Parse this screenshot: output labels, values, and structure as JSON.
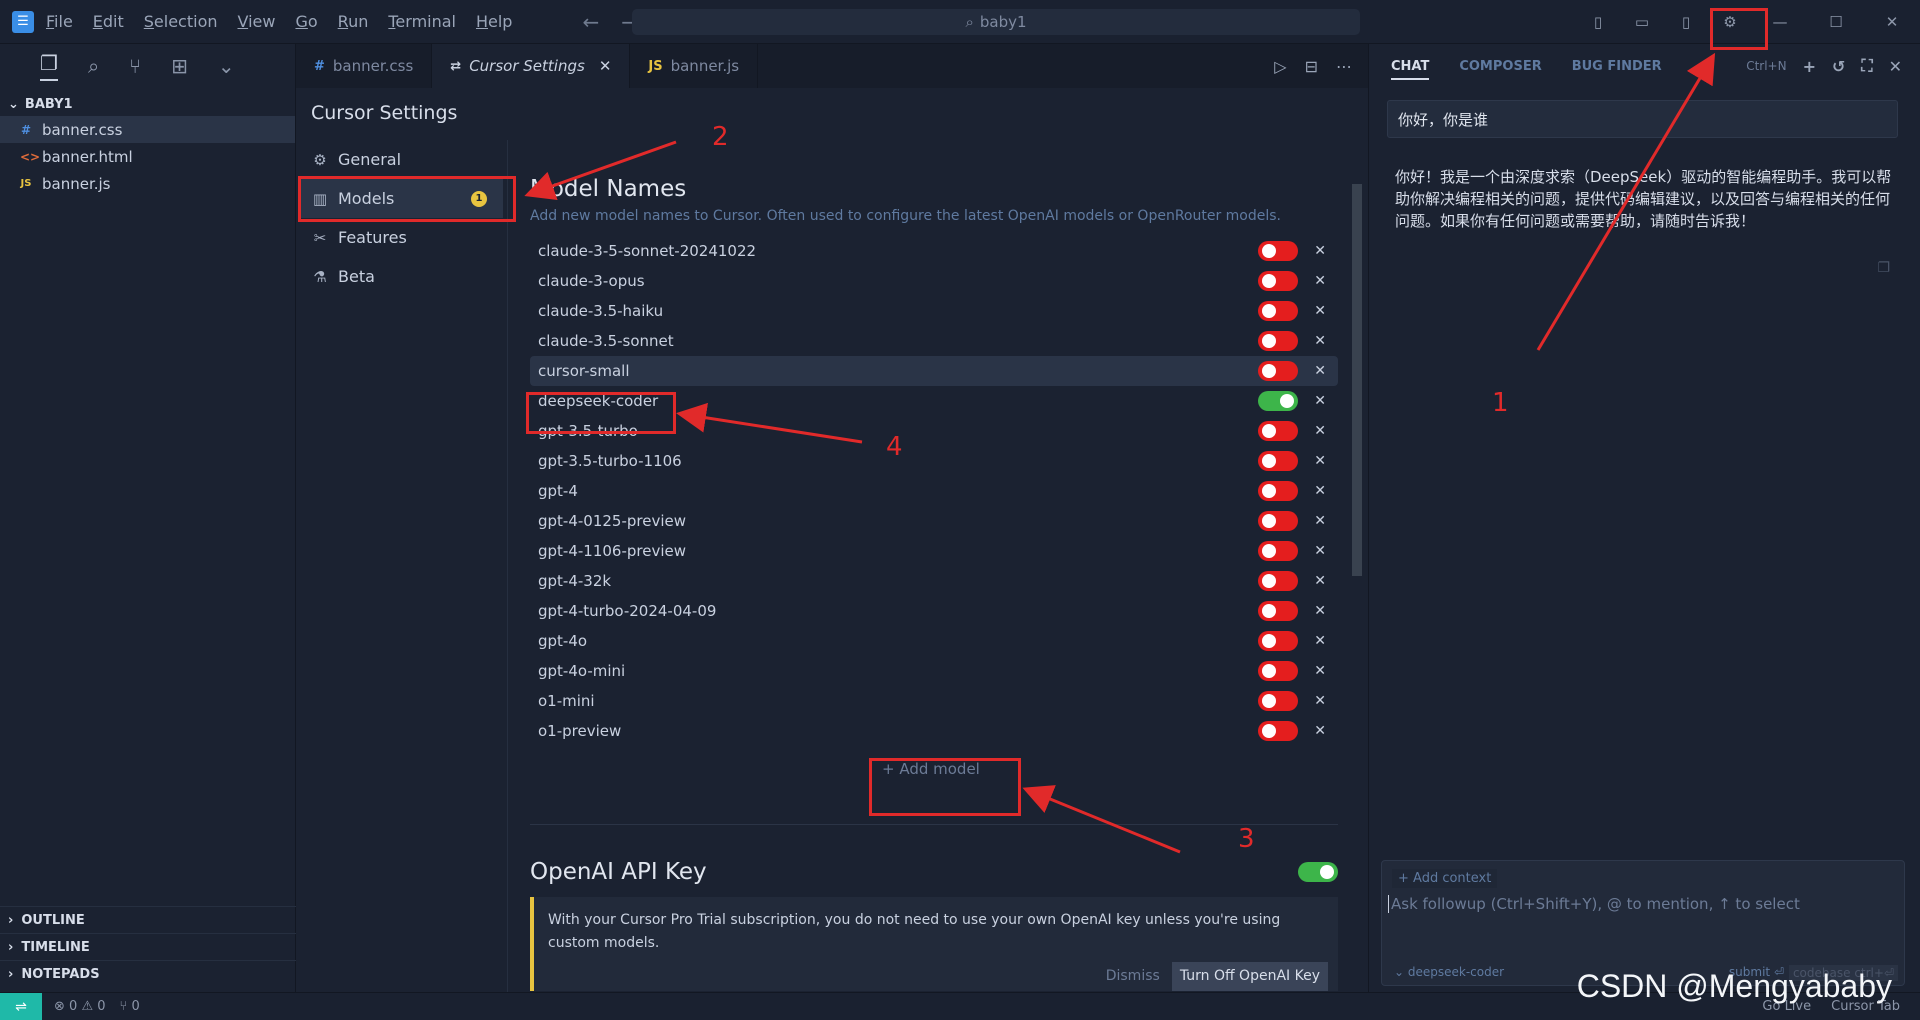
{
  "titlebar": {
    "menus": [
      "File",
      "Edit",
      "Selection",
      "View",
      "Go",
      "Run",
      "Terminal",
      "Help"
    ],
    "search_text": "baby1",
    "colors": {
      "accent": "#3a8ee6"
    }
  },
  "explorer": {
    "folder": "BABY1",
    "files": [
      {
        "name": "banner.css",
        "icon": "#"
      },
      {
        "name": "banner.html",
        "icon": "<>"
      },
      {
        "name": "banner.js",
        "icon": "JS"
      }
    ],
    "sections": [
      "OUTLINE",
      "TIMELINE",
      "NOTEPADS"
    ]
  },
  "tabs": [
    {
      "label": "banner.css",
      "icon": "#"
    },
    {
      "label": "Cursor Settings",
      "icon": "⇄"
    },
    {
      "label": "banner.js",
      "icon": "JS"
    }
  ],
  "settings": {
    "title": "Cursor Settings",
    "nav": [
      {
        "label": "General",
        "icon": "gear-icon"
      },
      {
        "label": "Models",
        "icon": "bar-chart-icon",
        "badge": "1"
      },
      {
        "label": "Features",
        "icon": "tools-icon"
      },
      {
        "label": "Beta",
        "icon": "flask-icon"
      }
    ],
    "model_names_title": "Model Names",
    "model_names_desc": "Add new model names to Cursor. Often used to configure the latest OpenAI models or OpenRouter models.",
    "models": [
      {
        "name": "claude-3-5-sonnet-20241022",
        "enabled": false
      },
      {
        "name": "claude-3-opus",
        "enabled": false
      },
      {
        "name": "claude-3.5-haiku",
        "enabled": false
      },
      {
        "name": "claude-3.5-sonnet",
        "enabled": false
      },
      {
        "name": "cursor-small",
        "enabled": false
      },
      {
        "name": "deepseek-coder",
        "enabled": true
      },
      {
        "name": "gpt-3.5-turbo",
        "enabled": false
      },
      {
        "name": "gpt-3.5-turbo-1106",
        "enabled": false
      },
      {
        "name": "gpt-4",
        "enabled": false
      },
      {
        "name": "gpt-4-0125-preview",
        "enabled": false
      },
      {
        "name": "gpt-4-1106-preview",
        "enabled": false
      },
      {
        "name": "gpt-4-32k",
        "enabled": false
      },
      {
        "name": "gpt-4-turbo-2024-04-09",
        "enabled": false
      },
      {
        "name": "gpt-4o",
        "enabled": false
      },
      {
        "name": "gpt-4o-mini",
        "enabled": false
      },
      {
        "name": "o1-mini",
        "enabled": false
      },
      {
        "name": "o1-preview",
        "enabled": false
      }
    ],
    "add_model_label": "+ Add model",
    "openai_title": "OpenAI API Key",
    "openai_enabled": true,
    "openai_notice": "With your Cursor Pro Trial subscription, you do not need to use your own OpenAI key unless you're using custom models.",
    "dismiss_label": "Dismiss",
    "turn_off_label": "Turn Off OpenAI Key"
  },
  "chat": {
    "tabs": [
      "CHAT",
      "COMPOSER",
      "BUG FINDER"
    ],
    "new_chat_shortcut": "Ctrl+N",
    "user_message": "你好，你是谁",
    "ai_message": "你好！我是一个由深度求索（DeepSeek）驱动的智能编程助手。我可以帮助你解决编程相关的问题，提供代码编辑建议，以及回答与编程相关的任何问题。如果你有任何问题或需要帮助，请随时告诉我！",
    "add_context": "+ Add context",
    "input_placeholder": "Ask followup (Ctrl+Shift+Y), @ to mention, ↑ to select",
    "model_selected": "deepseek-coder",
    "submit_label": "submit ⏎",
    "codebase_label": "codebase ctrl+⏎"
  },
  "statusbar": {
    "errors": "0",
    "warnings": "0",
    "ports": "0",
    "go_live": "Go Live",
    "cursor_tab": "Cursor Tab"
  },
  "annotations": [
    "1",
    "2",
    "3",
    "4"
  ],
  "watermark": "CSDN @Mengyababy",
  "colors": {
    "toggle_off": "#e41e1e",
    "toggle_on": "#3db54a",
    "annotation": "#e12a2a",
    "badge": "#e8c440"
  }
}
